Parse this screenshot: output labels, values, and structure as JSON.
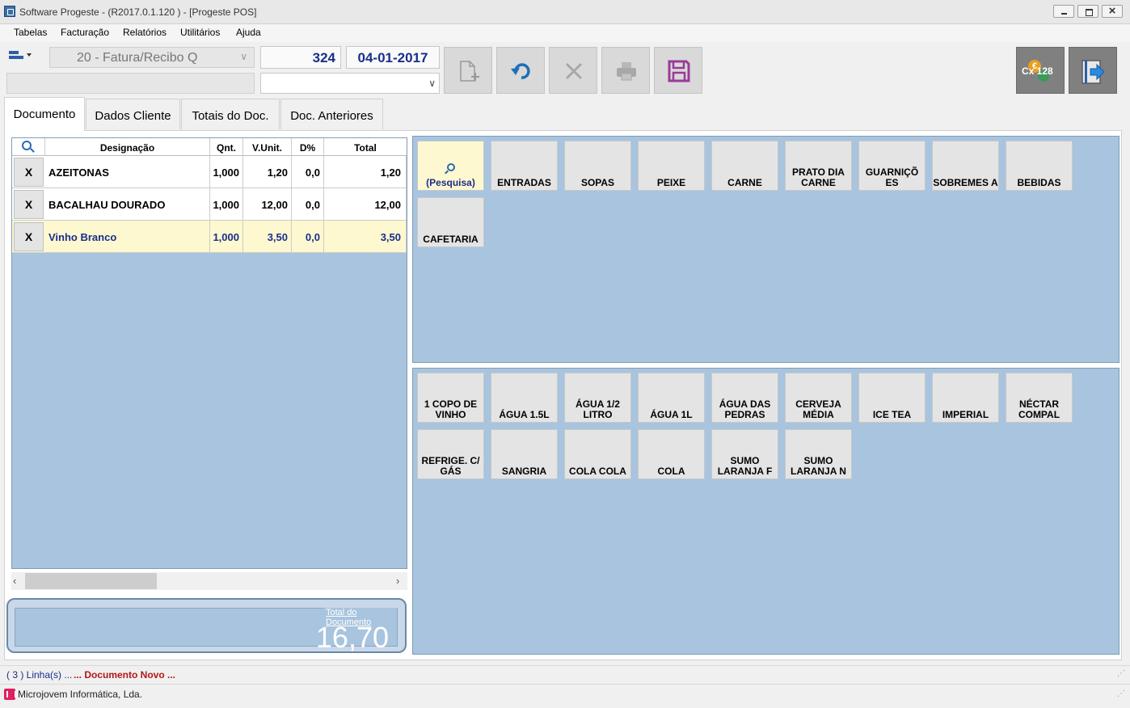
{
  "window": {
    "title": "Software Progeste - (R2017.0.1.120 ) - [Progeste POS]"
  },
  "menu": [
    "Tabelas",
    "Facturação",
    "Relatórios",
    "Utilitários",
    "Ajuda"
  ],
  "toolbar": {
    "doc_type": "20 - Fatura/Recibo Q",
    "doc_number": "324",
    "doc_date": "04-01-2017",
    "cash_label": "Cx 128"
  },
  "tabs": [
    "Documento",
    "Dados Cliente",
    "Totais do Doc.",
    "Doc. Anteriores"
  ],
  "grid": {
    "headers": {
      "designacao": "Designação",
      "qnt": "Qnt.",
      "vunit": "V.Unit.",
      "dp": "D%",
      "total": "Total"
    },
    "rows": [
      {
        "x": "X",
        "designacao": "AZEITONAS",
        "qnt": "1,000",
        "vunit": "1,20",
        "dp": "0,0",
        "total": "1,20"
      },
      {
        "x": "X",
        "designacao": "BACALHAU DOURADO",
        "qnt": "1,000",
        "vunit": "12,00",
        "dp": "0,0",
        "total": "12,00"
      },
      {
        "x": "X",
        "designacao": "Vinho Branco",
        "qnt": "1,000",
        "vunit": "3,50",
        "dp": "0,0",
        "total": "3,50"
      }
    ]
  },
  "total": {
    "label": "Total do Documento",
    "value": "16,70"
  },
  "categories": [
    "(Pesquisa)",
    "ENTRADAS",
    "SOPAS",
    "PEIXE",
    "CARNE",
    "PRATO DIA CARNE",
    "GUARNIÇÕ ES",
    "SOBREMES A",
    "BEBIDAS",
    "CAFETARIA"
  ],
  "products": [
    "1 COPO DE VINHO",
    "ÁGUA 1.5L",
    "ÁGUA 1/2 LITRO",
    "ÁGUA 1L",
    "ÁGUA DAS PEDRAS",
    "CERVEJA MÉDIA",
    "ICE TEA",
    "IMPERIAL",
    "NÉCTAR COMPAL",
    "REFRIGE. C/ GÁS",
    "SANGRIA",
    "COLA COLA",
    "COLA",
    "SUMO LARANJA F",
    "SUMO LARANJA N"
  ],
  "status": {
    "lines": "( 3 ) Linha(s) ...",
    "doc_state": "... Documento Novo ...",
    "company": "Microjovem Informática, Lda."
  }
}
